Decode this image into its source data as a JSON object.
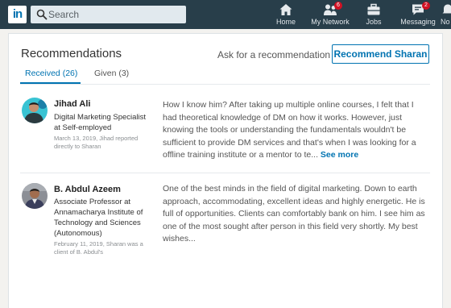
{
  "header": {
    "logo": "in",
    "search": {
      "placeholder": "Search"
    },
    "nav": [
      {
        "label": "Home",
        "icon": "home-icon"
      },
      {
        "label": "My Network",
        "icon": "network-icon",
        "badge": "6"
      },
      {
        "label": "Jobs",
        "icon": "briefcase-icon"
      },
      {
        "label": "Messaging",
        "icon": "messaging-icon",
        "badge": "2"
      },
      {
        "label": "No",
        "icon": "notifications-icon"
      }
    ]
  },
  "recommendations": {
    "title": "Recommendations",
    "ask_label": "Ask for a recommendation",
    "recommend_button": "Recommend Sharan",
    "tabs": [
      {
        "label": "Received (26)",
        "active": true
      },
      {
        "label": "Given (3)",
        "active": false
      }
    ],
    "items": [
      {
        "name": "Jihad Ali",
        "headline": "Digital Marketing Specialist at Self-employed",
        "meta": "March 13, 2019, Jihad reported directly to Sharan",
        "text": "How I know him? After taking up multiple online courses, I felt that I had theoretical knowledge of DM on how it works. However, just knowing the tools or understanding the fundamentals wouldn't be sufficient to provide DM services and that's when I was looking for a offline training institute or a mentor to te...",
        "see_more": "See more"
      },
      {
        "name": "B. Abdul Azeem",
        "headline": "Associate Professor at Annamacharya Institute of Technology and Sciences (Autonomous)",
        "meta": "February 11, 2019, Sharan was a client of B. Abdul's",
        "text": "One of the best minds in the field of digital marketing. Down to earth approach, accommodating, excellent ideas and highly energetic. He is full of opportunities. Clients can comfortably bank on him. I see him as one of the most sought after person in this field very shortly. My best wishes..."
      }
    ]
  },
  "colors": {
    "navbar": "#283e4a",
    "accent": "#0073b1",
    "badge": "#d11124"
  }
}
